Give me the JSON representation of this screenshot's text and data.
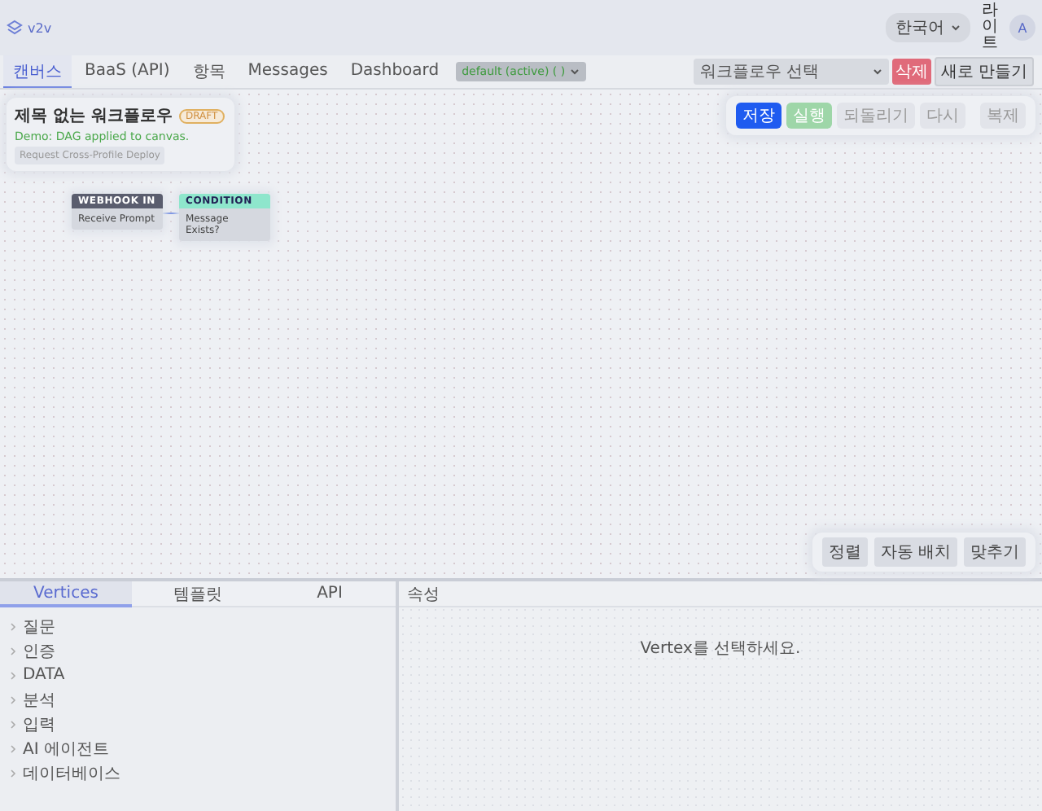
{
  "app": {
    "name": "v2v",
    "language": "한국어",
    "theme": "라이트",
    "avatar": "A"
  },
  "tabs": [
    {
      "label": "캔버스",
      "selected": true
    },
    {
      "label": "BaaS (API)",
      "selected": false
    },
    {
      "label": "항목",
      "selected": false
    },
    {
      "label": "Messages",
      "selected": false
    },
    {
      "label": "Dashboard",
      "selected": false
    }
  ],
  "profile_select": "default (active) ( )",
  "workflow_select": {
    "placeholder": "워크플로우 선택"
  },
  "delete_button": "삭제",
  "new_button": "새로 만들기",
  "workflow_card": {
    "title": "제목 없는 워크플로우",
    "badge": "DRAFT",
    "message": "Demo: DAG applied to canvas.",
    "action": "Request Cross-Profile Deploy"
  },
  "toolbar": [
    {
      "label": "저장",
      "kind": "primary"
    },
    {
      "label": "실행",
      "kind": "success"
    },
    {
      "label": "되돌리기",
      "kind": "plain"
    },
    {
      "label": "다시",
      "kind": "plain"
    },
    {
      "label": "복제",
      "kind": "plain"
    }
  ],
  "nodes": [
    {
      "type": "WEBHOOK IN",
      "label": "Receive Prompt",
      "kind": "webhook"
    },
    {
      "type": "CONDITION",
      "label": "Message Exists?",
      "kind": "condition"
    }
  ],
  "canvas_controls": [
    "정렬",
    "자동 배치",
    "맞추기"
  ],
  "panel_tabs": [
    {
      "label": "Vertices",
      "selected": true
    },
    {
      "label": "템플릿",
      "selected": false
    },
    {
      "label": "API",
      "selected": false
    }
  ],
  "categories": [
    {
      "label": "질문",
      "expanded": false
    },
    {
      "label": "인증",
      "expanded": false
    },
    {
      "label": "DATA",
      "expanded": false
    },
    {
      "label": "분석",
      "expanded": false
    },
    {
      "label": "입력",
      "expanded": false
    },
    {
      "label": "AI 에이전트",
      "expanded": false
    },
    {
      "label": "데이터베이스",
      "expanded": false
    }
  ],
  "properties": {
    "title": "속성",
    "empty": "Vertex를 선택하세요."
  }
}
